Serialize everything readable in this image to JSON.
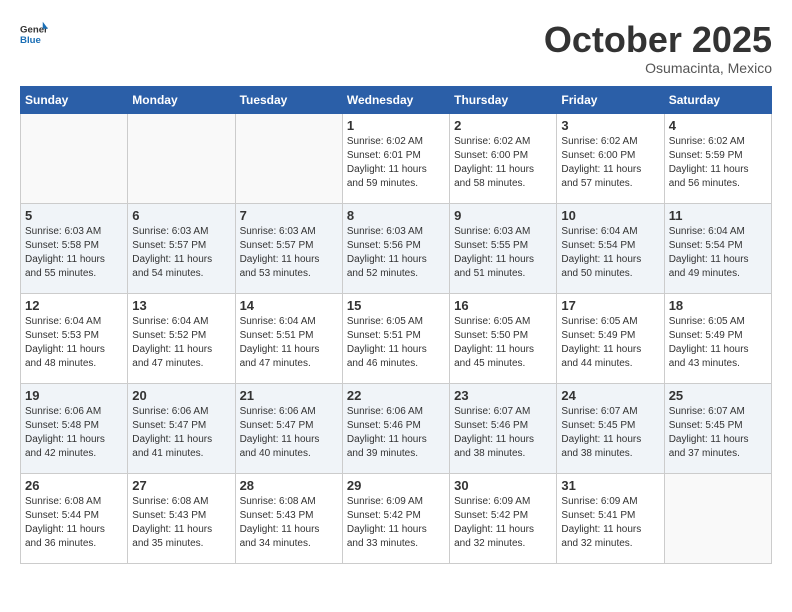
{
  "header": {
    "logo_general": "General",
    "logo_blue": "Blue",
    "month": "October 2025",
    "location": "Osumacinta, Mexico"
  },
  "weekdays": [
    "Sunday",
    "Monday",
    "Tuesday",
    "Wednesday",
    "Thursday",
    "Friday",
    "Saturday"
  ],
  "weeks": [
    [
      {
        "day": "",
        "info": ""
      },
      {
        "day": "",
        "info": ""
      },
      {
        "day": "",
        "info": ""
      },
      {
        "day": "1",
        "info": "Sunrise: 6:02 AM\nSunset: 6:01 PM\nDaylight: 11 hours\nand 59 minutes."
      },
      {
        "day": "2",
        "info": "Sunrise: 6:02 AM\nSunset: 6:00 PM\nDaylight: 11 hours\nand 58 minutes."
      },
      {
        "day": "3",
        "info": "Sunrise: 6:02 AM\nSunset: 6:00 PM\nDaylight: 11 hours\nand 57 minutes."
      },
      {
        "day": "4",
        "info": "Sunrise: 6:02 AM\nSunset: 5:59 PM\nDaylight: 11 hours\nand 56 minutes."
      }
    ],
    [
      {
        "day": "5",
        "info": "Sunrise: 6:03 AM\nSunset: 5:58 PM\nDaylight: 11 hours\nand 55 minutes."
      },
      {
        "day": "6",
        "info": "Sunrise: 6:03 AM\nSunset: 5:57 PM\nDaylight: 11 hours\nand 54 minutes."
      },
      {
        "day": "7",
        "info": "Sunrise: 6:03 AM\nSunset: 5:57 PM\nDaylight: 11 hours\nand 53 minutes."
      },
      {
        "day": "8",
        "info": "Sunrise: 6:03 AM\nSunset: 5:56 PM\nDaylight: 11 hours\nand 52 minutes."
      },
      {
        "day": "9",
        "info": "Sunrise: 6:03 AM\nSunset: 5:55 PM\nDaylight: 11 hours\nand 51 minutes."
      },
      {
        "day": "10",
        "info": "Sunrise: 6:04 AM\nSunset: 5:54 PM\nDaylight: 11 hours\nand 50 minutes."
      },
      {
        "day": "11",
        "info": "Sunrise: 6:04 AM\nSunset: 5:54 PM\nDaylight: 11 hours\nand 49 minutes."
      }
    ],
    [
      {
        "day": "12",
        "info": "Sunrise: 6:04 AM\nSunset: 5:53 PM\nDaylight: 11 hours\nand 48 minutes."
      },
      {
        "day": "13",
        "info": "Sunrise: 6:04 AM\nSunset: 5:52 PM\nDaylight: 11 hours\nand 47 minutes."
      },
      {
        "day": "14",
        "info": "Sunrise: 6:04 AM\nSunset: 5:51 PM\nDaylight: 11 hours\nand 47 minutes."
      },
      {
        "day": "15",
        "info": "Sunrise: 6:05 AM\nSunset: 5:51 PM\nDaylight: 11 hours\nand 46 minutes."
      },
      {
        "day": "16",
        "info": "Sunrise: 6:05 AM\nSunset: 5:50 PM\nDaylight: 11 hours\nand 45 minutes."
      },
      {
        "day": "17",
        "info": "Sunrise: 6:05 AM\nSunset: 5:49 PM\nDaylight: 11 hours\nand 44 minutes."
      },
      {
        "day": "18",
        "info": "Sunrise: 6:05 AM\nSunset: 5:49 PM\nDaylight: 11 hours\nand 43 minutes."
      }
    ],
    [
      {
        "day": "19",
        "info": "Sunrise: 6:06 AM\nSunset: 5:48 PM\nDaylight: 11 hours\nand 42 minutes."
      },
      {
        "day": "20",
        "info": "Sunrise: 6:06 AM\nSunset: 5:47 PM\nDaylight: 11 hours\nand 41 minutes."
      },
      {
        "day": "21",
        "info": "Sunrise: 6:06 AM\nSunset: 5:47 PM\nDaylight: 11 hours\nand 40 minutes."
      },
      {
        "day": "22",
        "info": "Sunrise: 6:06 AM\nSunset: 5:46 PM\nDaylight: 11 hours\nand 39 minutes."
      },
      {
        "day": "23",
        "info": "Sunrise: 6:07 AM\nSunset: 5:46 PM\nDaylight: 11 hours\nand 38 minutes."
      },
      {
        "day": "24",
        "info": "Sunrise: 6:07 AM\nSunset: 5:45 PM\nDaylight: 11 hours\nand 38 minutes."
      },
      {
        "day": "25",
        "info": "Sunrise: 6:07 AM\nSunset: 5:45 PM\nDaylight: 11 hours\nand 37 minutes."
      }
    ],
    [
      {
        "day": "26",
        "info": "Sunrise: 6:08 AM\nSunset: 5:44 PM\nDaylight: 11 hours\nand 36 minutes."
      },
      {
        "day": "27",
        "info": "Sunrise: 6:08 AM\nSunset: 5:43 PM\nDaylight: 11 hours\nand 35 minutes."
      },
      {
        "day": "28",
        "info": "Sunrise: 6:08 AM\nSunset: 5:43 PM\nDaylight: 11 hours\nand 34 minutes."
      },
      {
        "day": "29",
        "info": "Sunrise: 6:09 AM\nSunset: 5:42 PM\nDaylight: 11 hours\nand 33 minutes."
      },
      {
        "day": "30",
        "info": "Sunrise: 6:09 AM\nSunset: 5:42 PM\nDaylight: 11 hours\nand 32 minutes."
      },
      {
        "day": "31",
        "info": "Sunrise: 6:09 AM\nSunset: 5:41 PM\nDaylight: 11 hours\nand 32 minutes."
      },
      {
        "day": "",
        "info": ""
      }
    ]
  ]
}
